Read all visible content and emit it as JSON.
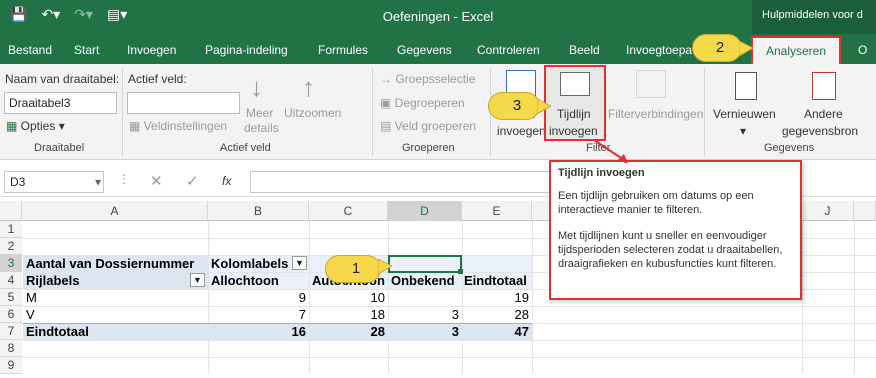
{
  "window": {
    "title": "Oefeningen - Excel",
    "tools_label": "Hulpmiddelen voor d"
  },
  "tabs": [
    "Bestand",
    "Start",
    "Invoegen",
    "Pagina-indeling",
    "Formules",
    "Gegevens",
    "Controleren",
    "Beeld",
    "Invoegtoepa"
  ],
  "active_tab": "Analyseren",
  "tab_overflow": "O",
  "ribbon": {
    "draaitabel": {
      "name_label": "Naam van draaitabel:",
      "name_value": "Draaitabel3",
      "opties": "Opties",
      "group": "Draaitabel"
    },
    "actief_veld": {
      "label": "Actief veld:",
      "veldinstellingen": "Veldinstellingen",
      "meer": "Meer",
      "details": "details",
      "uitzoomen": "Uitzoomen",
      "group": "Actief veld"
    },
    "groeperen": {
      "groepsselectie": "Groepsselectie",
      "degroeperen": "Degroeperen",
      "veld_groeperen": "Veld groeperen",
      "group": "Groeperen"
    },
    "filter": {
      "slicer_part": "er",
      "slicer_line2": "invoegen",
      "tijdlijn1": "Tijdlijn",
      "tijdlijn2": "invoegen",
      "filterverbindingen": "Filterverbindingen",
      "group": "Filter"
    },
    "gegevens": {
      "vernieuwen": "Vernieuwen",
      "andere1": "Andere",
      "andere2": "gegevensbron",
      "group": "Gegevens"
    }
  },
  "formula_bar": {
    "name_box": "D3",
    "fx": "fx"
  },
  "columns": [
    "A",
    "B",
    "C",
    "D",
    "E",
    "J"
  ],
  "rows": [
    "1",
    "2",
    "3",
    "4",
    "5",
    "6",
    "7",
    "8",
    "9"
  ],
  "pivot": {
    "r3": {
      "a": "Aantal van Dossiernummer",
      "b": "Kolomlabels"
    },
    "r4": {
      "a": "Rijlabels",
      "b": "Allochtoon",
      "c": "Autochtoon",
      "d": "Onbekend",
      "e": "Eindtotaal"
    },
    "r5": {
      "a": "M",
      "b": "9",
      "c": "10",
      "e": "19"
    },
    "r6": {
      "a": "V",
      "b": "7",
      "c": "18",
      "d": "3",
      "e": "28"
    },
    "r7": {
      "a": "Eindtotaal",
      "b": "16",
      "c": "28",
      "d": "3",
      "e": "47"
    }
  },
  "tooltip": {
    "title": "Tijdlijn invoegen",
    "p1": "Een tijdlijn gebruiken om datums op een interactieve manier te filteren.",
    "p2": "Met tijdlijnen kunt u sneller en eenvoudiger tijdsperioden selecteren zodat u draaitabellen, draaigrafieken en kubusfuncties kunt filteren."
  },
  "callouts": [
    "1",
    "2",
    "3"
  ],
  "colors": {
    "excel_green": "#217346",
    "highlight_red": "#e03030",
    "callout_yellow": "#f5d94a",
    "pivot_band": "#dce6f1"
  }
}
